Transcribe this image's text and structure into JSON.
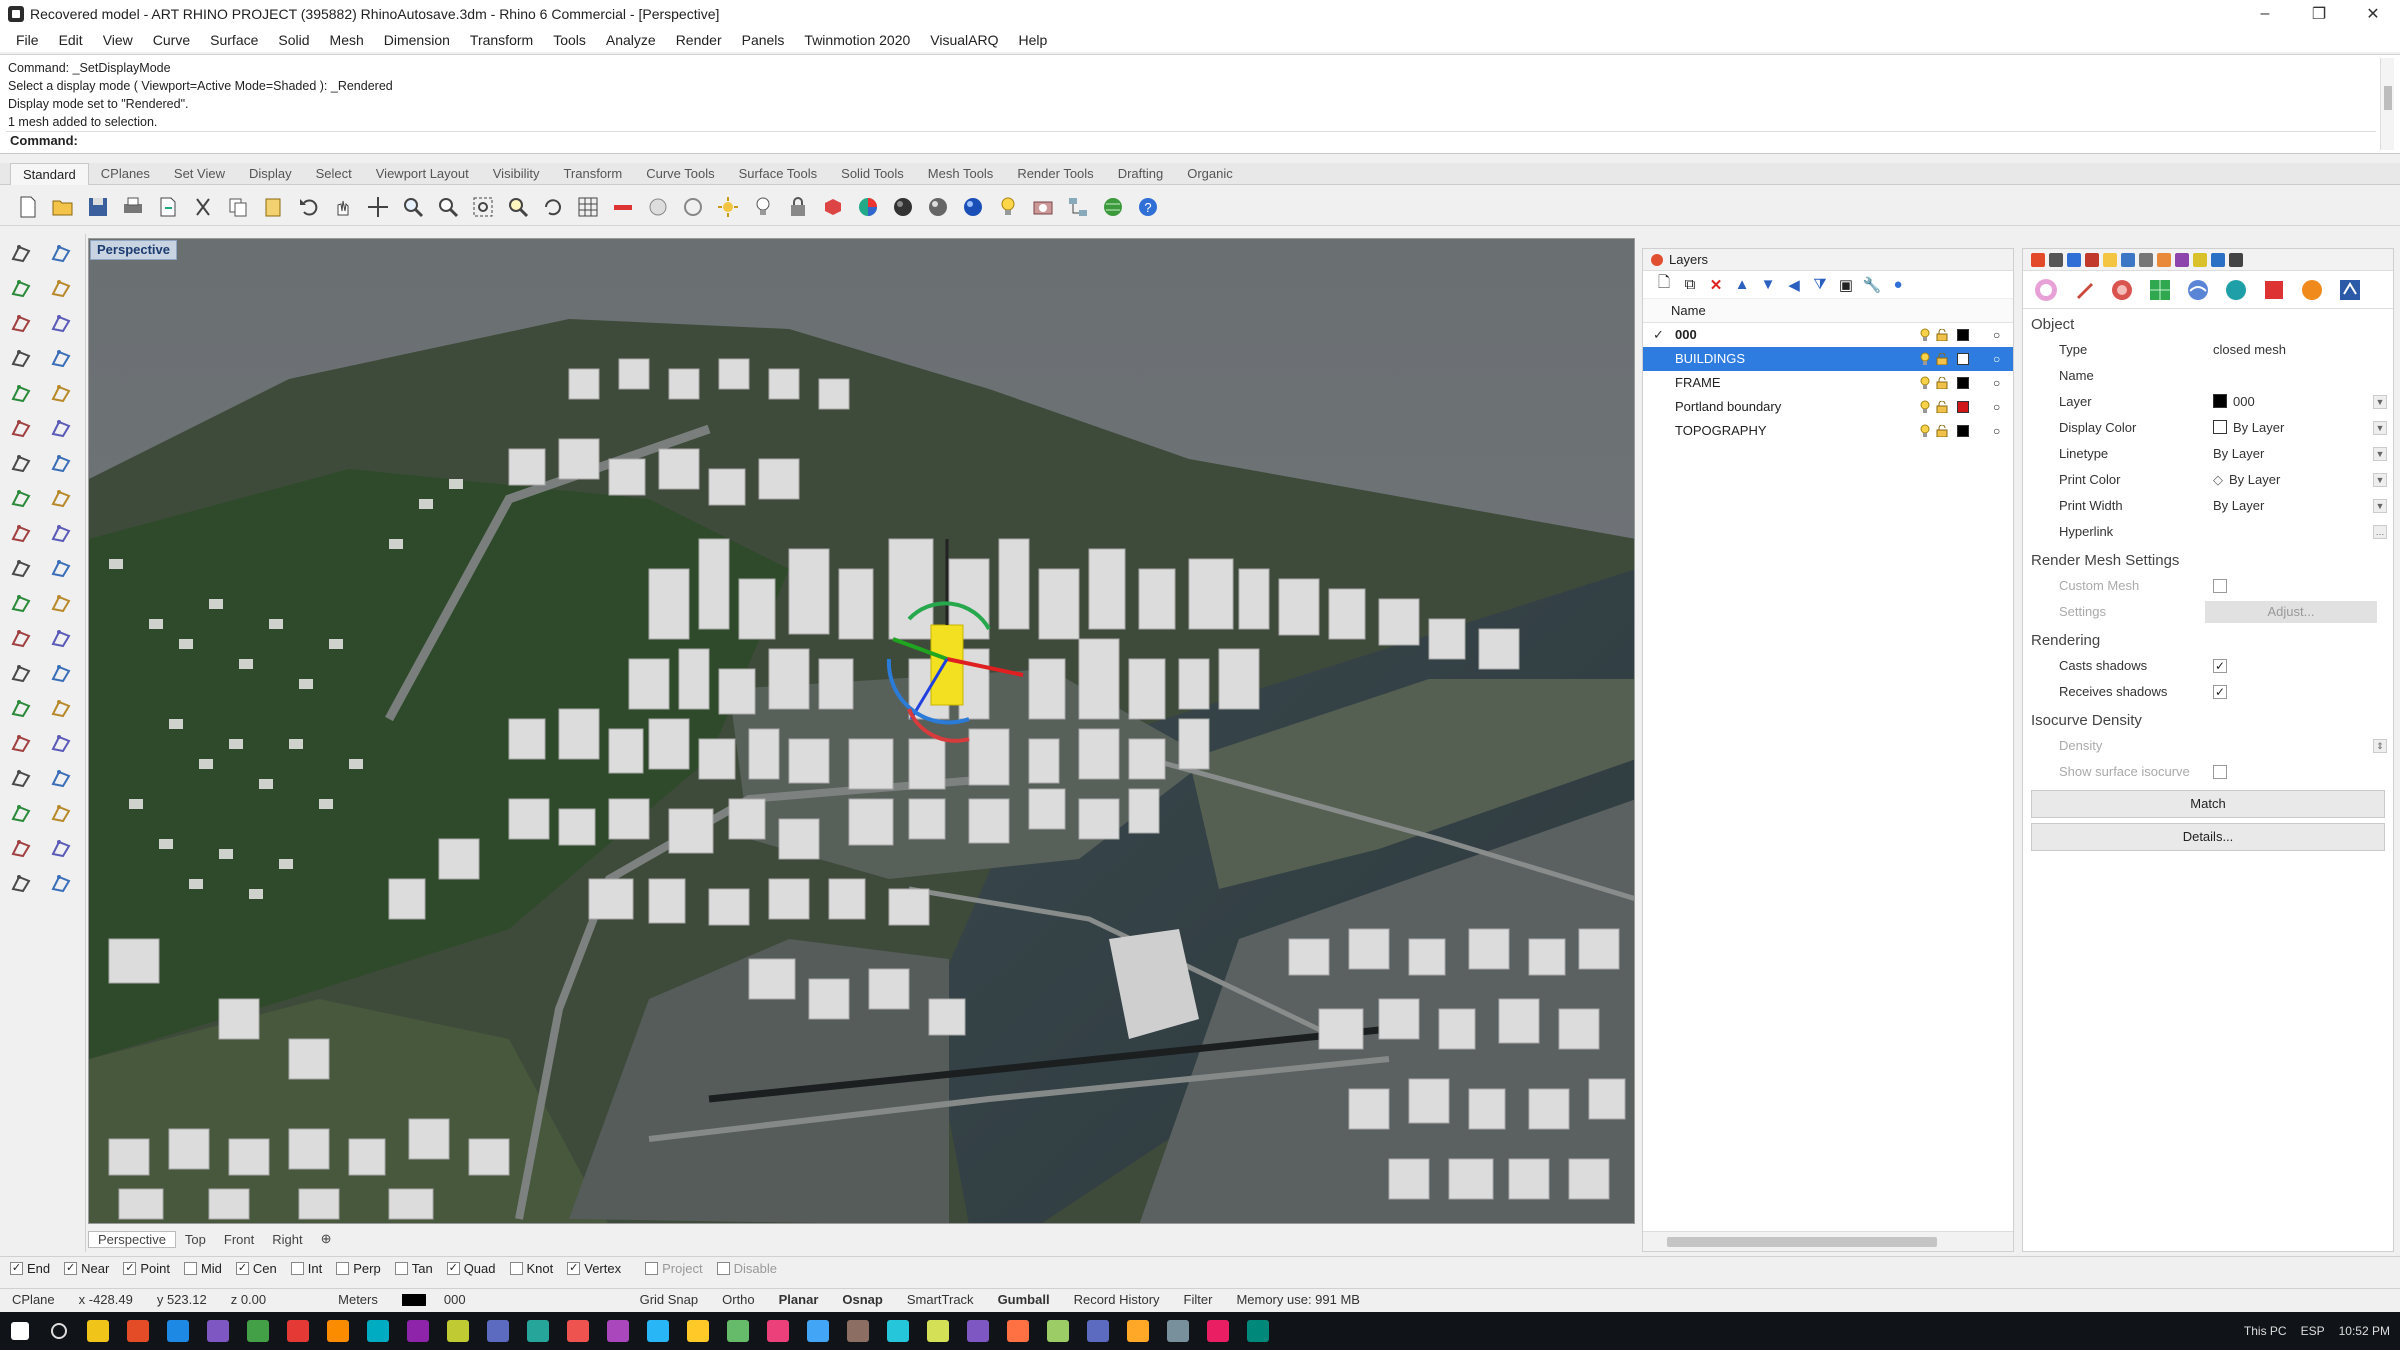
{
  "window": {
    "title": "Recovered model - ART RHINO PROJECT (395882) RhinoAutosave.3dm - Rhino 6 Commercial - [Perspective]",
    "controls": [
      "–",
      "❐",
      "✕"
    ]
  },
  "menu": [
    "File",
    "Edit",
    "View",
    "Curve",
    "Surface",
    "Solid",
    "Mesh",
    "Dimension",
    "Transform",
    "Tools",
    "Analyze",
    "Render",
    "Panels",
    "Twinmotion 2020",
    "VisualARQ",
    "Help"
  ],
  "command": {
    "history": [
      "Command: _SetDisplayMode",
      "Select a display mode ( Viewport=Active  Mode=Shaded ): _Rendered",
      "Display mode set to \"Rendered\".",
      "1 mesh added to selection."
    ],
    "prompt": "Command:"
  },
  "toolbar_tabs": [
    "Standard",
    "CPlanes",
    "Set View",
    "Display",
    "Select",
    "Viewport Layout",
    "Visibility",
    "Transform",
    "Curve Tools",
    "Surface Tools",
    "Solid Tools",
    "Mesh Tools",
    "Render Tools",
    "Drafting",
    "Organic"
  ],
  "toolbar_icons": [
    "new-icon",
    "open-icon",
    "save-icon",
    "print-icon",
    "import-icon",
    "cut-icon",
    "copy-icon",
    "paste-icon",
    "undo-icon",
    "pan-icon",
    "move-icon",
    "zoom-icon",
    "zoom-window-icon",
    "zoom-extents-icon",
    "zoom-selected-icon",
    "rotate-view-icon",
    "grid-icon",
    "cplane-icon",
    "snap-icon",
    "osnap-icon",
    "light-icon",
    "bulb-icon",
    "lock-icon",
    "material-icon",
    "color-wheel-icon",
    "sphere-icon",
    "shaded-sphere-icon",
    "render-sphere-icon",
    "light-bulb-icon",
    "camera-icon",
    "network-icon",
    "globe-icon",
    "help-icon"
  ],
  "viewport": {
    "label": "Perspective",
    "tabs": [
      "Perspective",
      "Top",
      "Front",
      "Right",
      "⊕"
    ]
  },
  "layers": {
    "title": "Layers",
    "column_name": "Name",
    "rows": [
      {
        "name": "000",
        "current": true,
        "color": "#000000",
        "selected": false
      },
      {
        "name": "BUILDINGS",
        "current": false,
        "color": "#ffffff",
        "selected": true
      },
      {
        "name": "FRAME",
        "current": false,
        "color": "#000000",
        "selected": false
      },
      {
        "name": "Portland boundary",
        "current": false,
        "color": "#d01818",
        "selected": false
      },
      {
        "name": "TOPOGRAPHY",
        "current": false,
        "color": "#000000",
        "selected": false
      }
    ]
  },
  "properties": {
    "object_title": "Object",
    "type_label": "Type",
    "type_value": "closed mesh",
    "name_label": "Name",
    "name_value": "",
    "layer_label": "Layer",
    "layer_value": "000",
    "display_color_label": "Display Color",
    "display_color_value": "By Layer",
    "linetype_label": "Linetype",
    "linetype_value": "By Layer",
    "print_color_label": "Print Color",
    "print_color_value": "By Layer",
    "print_width_label": "Print Width",
    "print_width_value": "By Layer",
    "hyperlink_label": "Hyperlink",
    "render_mesh_title": "Render Mesh Settings",
    "custom_mesh_label": "Custom Mesh",
    "settings_label": "Settings",
    "adjust_label": "Adjust...",
    "rendering_title": "Rendering",
    "casts_shadows_label": "Casts shadows",
    "receives_shadows_label": "Receives shadows",
    "isocurve_title": "Isocurve Density",
    "density_label": "Density",
    "show_iso_label": "Show surface isocurve",
    "match_label": "Match",
    "details_label": "Details..."
  },
  "osnap": [
    {
      "label": "End",
      "checked": true
    },
    {
      "label": "Near",
      "checked": true
    },
    {
      "label": "Point",
      "checked": true
    },
    {
      "label": "Mid",
      "checked": false
    },
    {
      "label": "Cen",
      "checked": true
    },
    {
      "label": "Int",
      "checked": false
    },
    {
      "label": "Perp",
      "checked": false
    },
    {
      "label": "Tan",
      "checked": false
    },
    {
      "label": "Quad",
      "checked": true
    },
    {
      "label": "Knot",
      "checked": false
    },
    {
      "label": "Vertex",
      "checked": true
    },
    {
      "label": "Project",
      "checked": false
    },
    {
      "label": "Disable",
      "checked": false
    }
  ],
  "status": {
    "cplane": "CPlane",
    "x": "x -428.49",
    "y": "y 523.12",
    "z": "z 0.00",
    "units": "Meters",
    "layer": "000",
    "grid_snap": "Grid Snap",
    "ortho": "Ortho",
    "planar": "Planar",
    "osnap": "Osnap",
    "smarttrack": "SmartTrack",
    "gumball": "Gumball",
    "record_history": "Record History",
    "filter": "Filter",
    "memory": "Memory use: 991 MB"
  },
  "taskbar": {
    "this_pc": "This PC",
    "lang": "ESP",
    "time": "10:52 PM",
    "icon_colors": [
      "#f0c419",
      "#e34c26",
      "#1e88e5",
      "#7e57c2",
      "#43a047",
      "#e53935",
      "#fb8c00",
      "#00acc1",
      "#8e24aa",
      "#c0ca33",
      "#5c6bc0",
      "#26a69a",
      "#ef5350",
      "#ab47bc",
      "#29b6f6",
      "#ffca28",
      "#66bb6a",
      "#ec407a",
      "#42a5f5",
      "#8d6e63",
      "#26c6da",
      "#d4e157",
      "#7e57c2",
      "#ff7043",
      "#9ccc65",
      "#5c6bc0",
      "#ffa726",
      "#78909c",
      "#e91e63",
      "#00897b"
    ]
  }
}
